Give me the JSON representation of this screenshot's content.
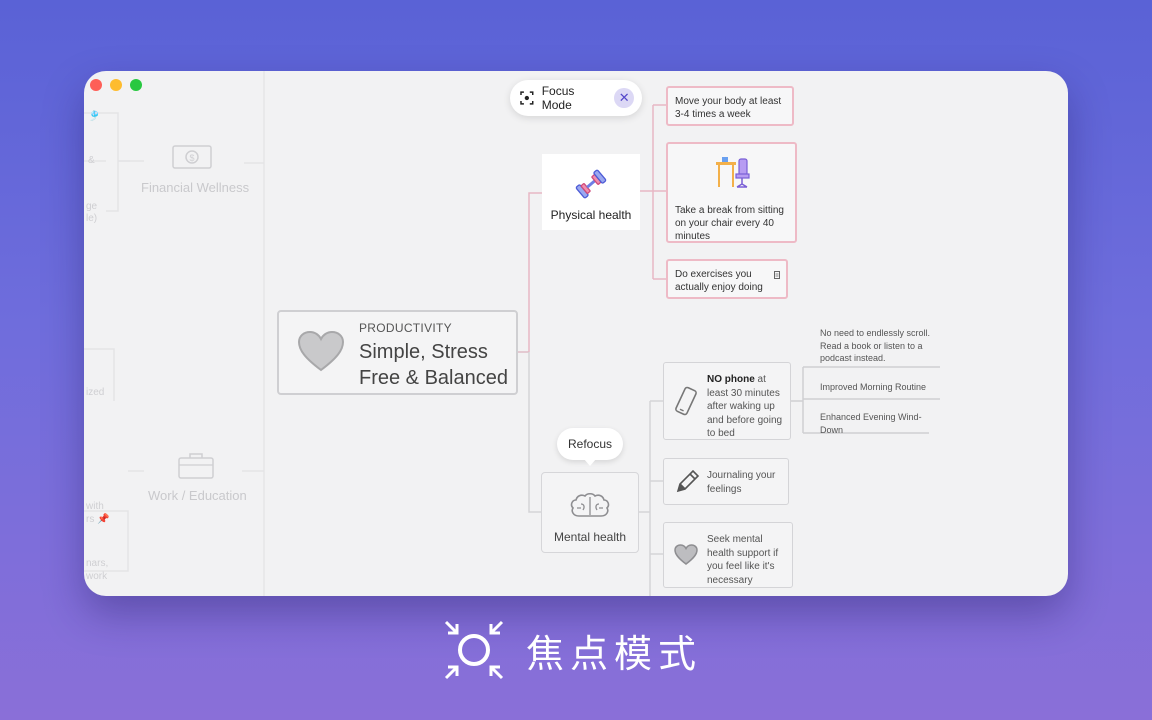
{
  "window": {
    "focus_pill": {
      "label": "Focus Mode",
      "close_symbol": "✕"
    },
    "central": {
      "kicker": "PRODUCTIVITY",
      "title": "Simple, Stress Free & Balanced",
      "icon": "heart-icon"
    },
    "faded_left": {
      "financial": "Financial Wellness",
      "work": "Work / Education",
      "frag_ge": "ge",
      "frag_le": "le)",
      "frag_ized": "ized",
      "frag_with": "with",
      "frag_rs": "rs 📌",
      "frag_nars": "nars,",
      "frag_work": "work"
    },
    "physical": {
      "label": "Physical health",
      "icon": "dumbbell-icon",
      "cards": [
        "Move your body at least 3-4 times a week",
        "Take a break from sitting on your chair every 40 minutes",
        "Do exercises you actually enjoy doing"
      ]
    },
    "mental": {
      "label": "Mental health",
      "icon": "brain-icon",
      "refocus": "Refocus",
      "cards": {
        "phone_bold": "NO phone",
        "phone_rest": " at least 30 minutes after waking up and before going to bed",
        "journal": "Journaling your feelings",
        "support": "Seek mental health support if you feel like it's necessary"
      },
      "leaves": [
        "No need to endlessly scroll. Read a book or listen to a podcast instead.",
        "Improved Morning Routine",
        "Enhanced Evening Wind-Down"
      ]
    }
  },
  "caption": {
    "text": "焦点模式",
    "icon": "focus-mode-icon"
  },
  "colors": {
    "accent_pink": "#eebac6",
    "focus_purple": "#5447c9",
    "background_top": "#5a62d6",
    "background_bottom": "#8a6fd8"
  }
}
